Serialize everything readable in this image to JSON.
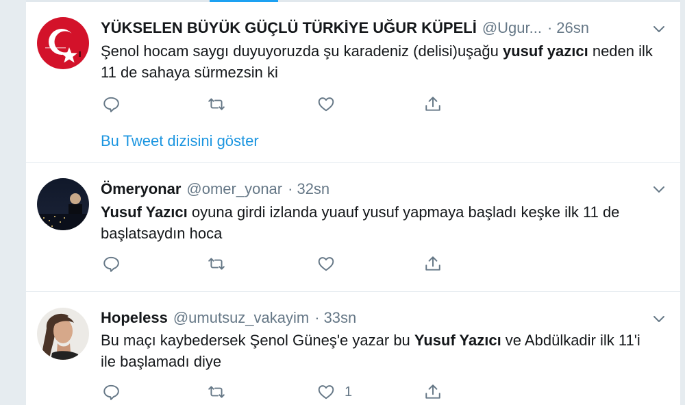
{
  "colors": {
    "accent": "#1da1f2",
    "link": "#1b95e0",
    "secondary": "#657786",
    "text": "#14171a"
  },
  "tweets": [
    {
      "name": "YÜKSELEN BÜYÜK GÜÇLÜ TÜRKİYE UĞUR KÜPELİ",
      "handle": "@Ugur...",
      "time": "26sn",
      "text_a": "Şenol hocam saygı duyuyoruzda şu karadeniz (delisi)uşağu ",
      "text_b": "yusuf yazıcı",
      "text_c": " neden ilk 11 de sahaya sürmezsin ki",
      "like_count": "",
      "thread_link": "Bu Tweet dizisini göster",
      "avatar_icon": "turkish-flag-avatar"
    },
    {
      "name": "Ömeryonar",
      "handle": "@omer_yonar",
      "time": "32sn",
      "text_a": "",
      "text_b": "Yusuf Yazıcı",
      "text_c": " oyuna girdi izlanda yuauf yusuf yapmaya başladı keşke ilk 11 de başlatsaydın hoca",
      "like_count": "",
      "avatar_icon": "night-city-avatar"
    },
    {
      "name": "Hopeless",
      "handle": "@umutsuz_vakayim",
      "time": "33sn",
      "text_a": "Bu maçı kaybedersek Şenol Güneş'e yazar bu ",
      "text_b": "Yusuf Yazıcı",
      "text_c": " ve Abdülkadir ilk 11'i ile başlamadı diye",
      "like_count": "1",
      "avatar_icon": "woman-portrait-avatar"
    }
  ],
  "separator": "·",
  "icons": {
    "reply": "reply-icon",
    "retweet": "retweet-icon",
    "like": "heart-icon",
    "share": "share-icon",
    "caret": "chevron-down-icon"
  }
}
